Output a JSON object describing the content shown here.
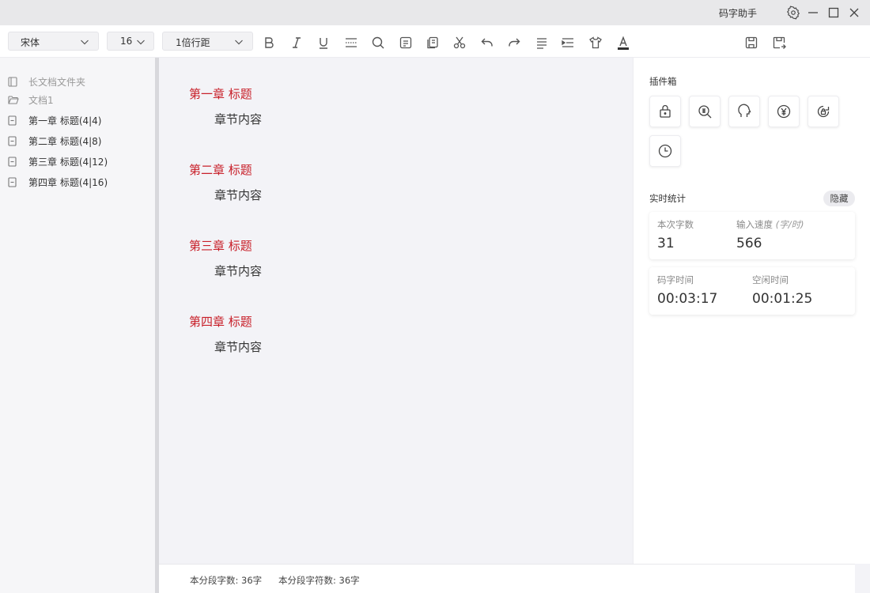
{
  "titlebar": {
    "app_name": "码字助手",
    "icons": [
      "gear-icon",
      "minimize-icon",
      "maximize-icon",
      "close-icon"
    ]
  },
  "toolbar": {
    "font_family": "宋体",
    "font_size": "16",
    "line_spacing": "1倍行距",
    "tools": [
      "bold",
      "italic",
      "underline",
      "separator-line",
      "search",
      "notes",
      "copy-document",
      "cut",
      "undo",
      "redo",
      "align",
      "indent",
      "theme-shirt",
      "font-color",
      "save",
      "save-as"
    ]
  },
  "sidebar": {
    "folder_label": "长文档文件夹",
    "doc_label": "文档1",
    "chapters": [
      {
        "label": "第一章 标题(4|4)"
      },
      {
        "label": "第二章 标题(4|8)"
      },
      {
        "label": "第三章 标题(4|12)"
      },
      {
        "label": "第四章 标题(4|16)"
      }
    ]
  },
  "editor": {
    "title_color": "#c8202a",
    "chapters": [
      {
        "title": "第一章 标题",
        "body": "章节内容"
      },
      {
        "title": "第二章 标题",
        "body": "章节内容"
      },
      {
        "title": "第三章 标题",
        "body": "章节内容"
      },
      {
        "title": "第四章 标题",
        "body": "章节内容"
      }
    ]
  },
  "status": {
    "chars": "本分段字数: 36字",
    "symbols": "本分段字符数: 36字"
  },
  "plugins": {
    "title": "插件箱",
    "items": [
      "lock-icon",
      "dictionary-search-icon",
      "head-icon",
      "yen-icon",
      "lock-refresh-icon",
      "clock-icon"
    ]
  },
  "stats": {
    "title": "实时统计",
    "hide_label": "隐藏",
    "session_chars_label": "本次字数",
    "session_chars": "31",
    "speed_label": "输入速度",
    "speed_unit": "(字/时)",
    "speed": "566",
    "typing_time_label": "码字时间",
    "typing_time": "00:03:17",
    "idle_time_label": "空闲时间",
    "idle_time": "00:01:25"
  }
}
